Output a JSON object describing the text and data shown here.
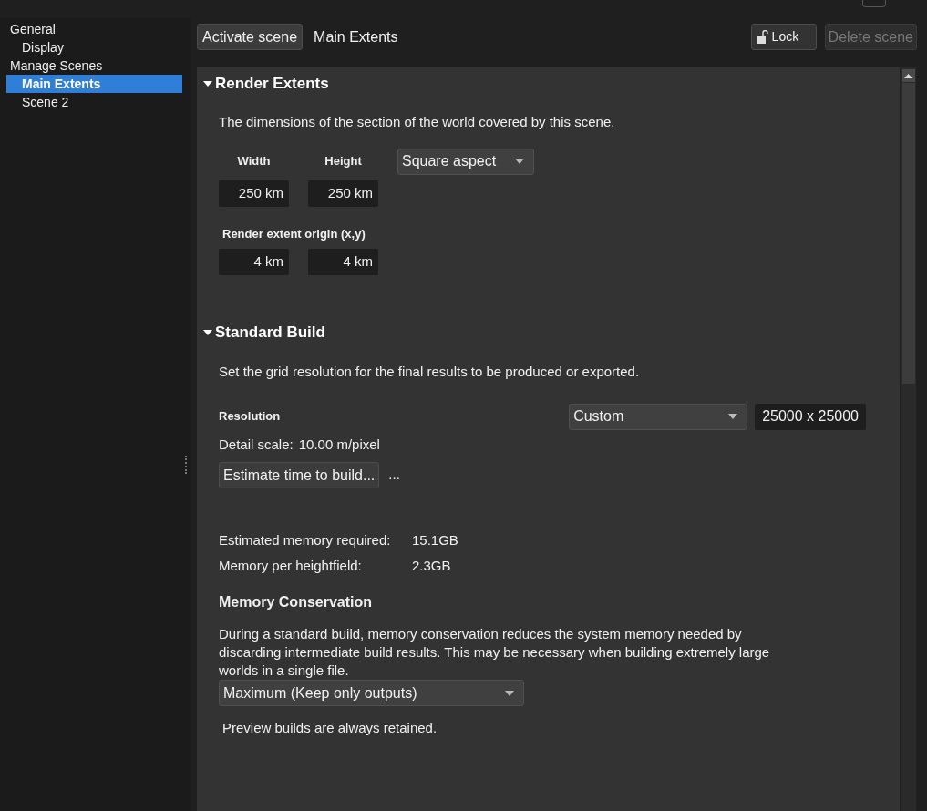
{
  "sidebar": {
    "items": [
      {
        "label": "General",
        "selected": false,
        "children": [
          {
            "label": "Display",
            "selected": false
          }
        ]
      },
      {
        "label": "Manage Scenes",
        "selected": false,
        "children": [
          {
            "label": "Main Extents",
            "selected": true
          },
          {
            "label": "Scene 2",
            "selected": false
          }
        ]
      }
    ]
  },
  "toolbar": {
    "activate_button": "Activate scene",
    "scene_name": "Main Extents",
    "lock_button": "Lock",
    "delete_button": {
      "label": "Delete scene",
      "disabled": true
    }
  },
  "render_extents": {
    "title": "Render Extents",
    "expanded": true,
    "description": "The dimensions of the section of the world covered by this scene.",
    "width_label": "Width",
    "height_label": "Height",
    "aspect_dropdown": "Square aspect",
    "width": "250 km",
    "height": "250 km",
    "origin_label": "Render extent origin (x,y)",
    "origin_x": "4 km",
    "origin_y": "4 km"
  },
  "standard_build": {
    "title": "Standard Build",
    "expanded": true,
    "description": "Set the grid resolution for the final results to be produced or exported.",
    "resolution_label": "Resolution",
    "resolution_dropdown": "Custom",
    "resolution_value": "25000 x 25000",
    "detail_scale_label": "Detail scale:",
    "detail_scale": "10.00 m/pixel",
    "estimate_button": "Estimate time to build...",
    "estimate_result": "...",
    "memory_required_label": "Estimated memory required:",
    "memory_required": "15.1GB",
    "memory_heightfield_label": "Memory per heightfield:",
    "memory_heightfield": "2.3GB",
    "conservation_title": "Memory Conservation",
    "conservation_description": "During a standard build, memory conservation reduces the system memory needed by discarding intermediate build results. This may be necessary when building extremely large worlds in a single file.",
    "conservation_dropdown": "Maximum (Keep only outputs)",
    "preview_note": "Preview builds are always retained."
  }
}
